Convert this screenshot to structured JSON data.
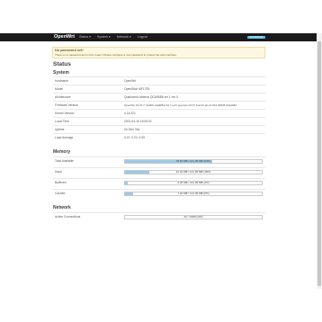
{
  "header": {
    "brand": "OpenWrt",
    "menu": [
      "Status ▾",
      "System ▾",
      "Network ▾",
      "Logout"
    ],
    "autorefresh": "Auto Refresh"
  },
  "alert": {
    "title": "No password set!",
    "text": "There is no password set on this router. Please configure a root password to protect the web interface."
  },
  "page_title": "Status",
  "system": {
    "title": "System",
    "rows": [
      {
        "label": "Hostname",
        "value": "OpenWrt"
      },
      {
        "label": "Model",
        "value": "OpenStick MF1793"
      },
      {
        "label": "Architecture",
        "value": "Qualcomm Atheros QCA9558 ver 1 rev 0"
      },
      {
        "label": "Firmware Version",
        "value": "OpenWrt 19.07.7 r11306-c4a6851c72 / LuCI openwrt-19.07 branch git-21.044.30835-34e0b8d"
      },
      {
        "label": "Kernel Version",
        "value": "4.14.221"
      },
      {
        "label": "Local Time",
        "value": "2021-04-15 15:05:02"
      },
      {
        "label": "Uptime",
        "value": "0h 15m 34s"
      },
      {
        "label": "Load Average",
        "value": "0.47, 0.24, 0.09"
      }
    ]
  },
  "memory": {
    "title": "Memory",
    "rows": [
      {
        "label": "Total Available",
        "text": "78.03 MB / 121.35 MB (64%)",
        "percent": 64
      },
      {
        "label": "Used",
        "text": "22.42 MB / 121.35 MB (18%)",
        "percent": 18
      },
      {
        "label": "Buffered",
        "text": "2.35 MB / 121.35 MB (2%)",
        "percent": 2
      },
      {
        "label": "Cached",
        "text": "7.43 MB / 121.35 MB (6%)",
        "percent": 6
      }
    ]
  },
  "network": {
    "title": "Network",
    "rows": [
      {
        "label": "Active Connections",
        "text": "32 / 16384 (0%)",
        "percent": 0
      }
    ]
  }
}
